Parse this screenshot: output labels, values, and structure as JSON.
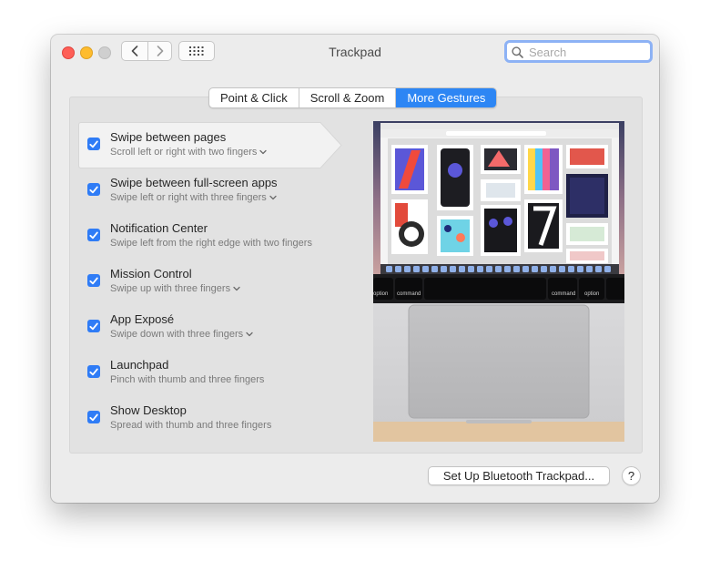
{
  "window": {
    "title": "Trackpad"
  },
  "search": {
    "placeholder": "Search"
  },
  "tabs": [
    {
      "label": "Point & Click",
      "active": false
    },
    {
      "label": "Scroll & Zoom",
      "active": false
    },
    {
      "label": "More Gestures",
      "active": true
    }
  ],
  "gestures": [
    {
      "title": "Swipe between pages",
      "subtitle": "Scroll left or right with two fingers",
      "checked": true,
      "has_dropdown": true,
      "selected": true
    },
    {
      "title": "Swipe between full-screen apps",
      "subtitle": "Swipe left or right with three fingers",
      "checked": true,
      "has_dropdown": true
    },
    {
      "title": "Notification Center",
      "subtitle": "Swipe left from the right edge with two fingers",
      "checked": true,
      "has_dropdown": false
    },
    {
      "title": "Mission Control",
      "subtitle": "Swipe up with three fingers",
      "checked": true,
      "has_dropdown": true
    },
    {
      "title": "App Exposé",
      "subtitle": "Swipe down with three fingers",
      "checked": true,
      "has_dropdown": true
    },
    {
      "title": "Launchpad",
      "subtitle": "Pinch with thumb and three fingers",
      "checked": true,
      "has_dropdown": false
    },
    {
      "title": "Show Desktop",
      "subtitle": "Spread with thumb and three fingers",
      "checked": true,
      "has_dropdown": false
    }
  ],
  "preview": {
    "keys": {
      "option": "option",
      "command": "command"
    },
    "icon": "trackpad-demo-image"
  },
  "footer": {
    "setup_label": "Set Up Bluetooth Trackpad...",
    "help_label": "?"
  },
  "colors": {
    "accent": "#2d86f4",
    "checkbox": "#2f7cf6",
    "search_focus": "#8db2f5"
  }
}
